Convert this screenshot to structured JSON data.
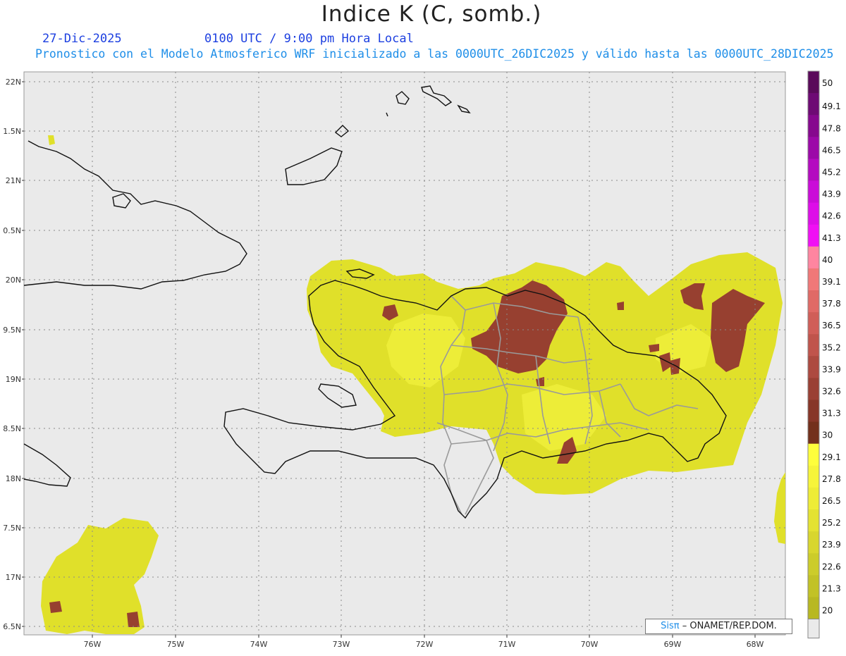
{
  "header": {
    "title": "Indice K (C, somb.)",
    "date": "27-Dic-2025",
    "time": "0100 UTC / 9:00 pm Hora Local",
    "subtitle": "Pronostico con el Modelo Atmosferico WRF inicializado a las 0000UTC_26DIC2025 y válido hasta las  0000UTC_28DIC2025"
  },
  "axes": {
    "lat_labels": [
      "22N",
      "1.5N",
      "21N",
      "0.5N",
      "20N",
      "9.5N",
      "19N",
      "8.5N",
      "18N",
      "7.5N",
      "17N",
      "6.5N"
    ],
    "lon_labels": [
      "76W",
      "75W",
      "74W",
      "73W",
      "72W",
      "71W",
      "70W",
      "69W",
      "68W"
    ]
  },
  "colorbar": {
    "labels": [
      "50",
      "49.1",
      "47.8",
      "46.5",
      "45.2",
      "43.9",
      "42.6",
      "41.3",
      "40",
      "39.1",
      "37.8",
      "36.5",
      "35.2",
      "33.9",
      "32.6",
      "31.3",
      "30",
      "29.1",
      "27.8",
      "26.5",
      "25.2",
      "23.9",
      "22.6",
      "21.3",
      "20"
    ],
    "colors": [
      "#5a0a5a",
      "#6e0a74",
      "#86088e",
      "#9c09a8",
      "#b40bc0",
      "#ca0cd8",
      "#dd0ee8",
      "#f010f4",
      "#ff85a0",
      "#f07878",
      "#e06a66",
      "#d05e58",
      "#c0544c",
      "#ad4a40",
      "#9a4034",
      "#873628",
      "#73301c",
      "#fefe3c",
      "#f6f43a",
      "#eeec36",
      "#e4e232",
      "#d8d62e",
      "#cccc2a",
      "#c2c226",
      "#b8b822"
    ],
    "bottom_color": "#eaeaea"
  },
  "colors": {
    "map_background": "#eaeaea",
    "field_yellow": "#e2e22c",
    "field_yellow_light": "#efef3a",
    "field_brown": "#974030",
    "coast": "#111111",
    "province_border": "#9a9a9a"
  },
  "credit": {
    "brand": "Sisπ",
    "text": "– ONAMET/REP.DOM."
  }
}
